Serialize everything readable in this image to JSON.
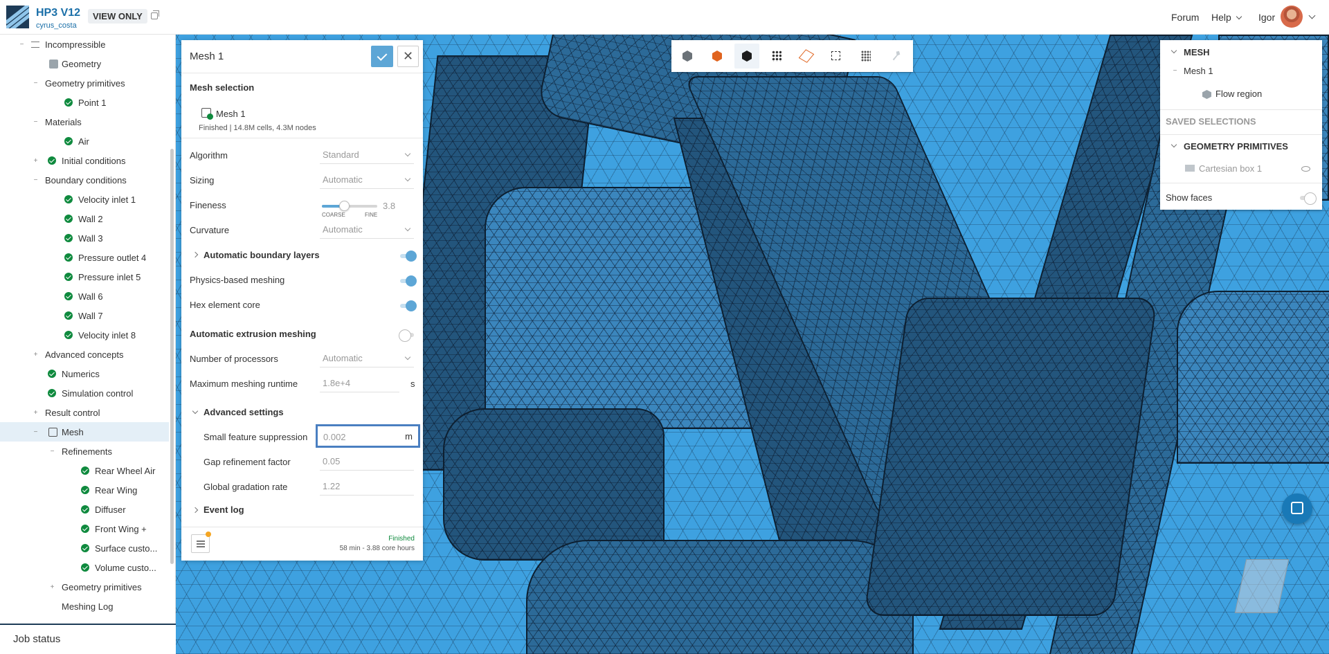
{
  "header": {
    "project_title": "HP3 V12",
    "project_owner": "cyrus_costa",
    "view_only_badge": "VIEW ONLY",
    "nav_forum": "Forum",
    "nav_help": "Help",
    "user_name": "Igor"
  },
  "tree": {
    "items": [
      {
        "label": "Incompressible"
      },
      {
        "label": "Geometry"
      },
      {
        "label": "Geometry primitives"
      },
      {
        "label": "Point 1"
      },
      {
        "label": "Materials"
      },
      {
        "label": "Air"
      },
      {
        "label": "Initial conditions"
      },
      {
        "label": "Boundary conditions"
      },
      {
        "label": "Velocity inlet 1"
      },
      {
        "label": "Wall 2"
      },
      {
        "label": "Wall 3"
      },
      {
        "label": "Pressure outlet 4"
      },
      {
        "label": "Pressure inlet 5"
      },
      {
        "label": "Wall 6"
      },
      {
        "label": "Wall 7"
      },
      {
        "label": "Velocity inlet 8"
      },
      {
        "label": "Advanced concepts"
      },
      {
        "label": "Numerics"
      },
      {
        "label": "Simulation control"
      },
      {
        "label": "Result control"
      },
      {
        "label": "Mesh"
      },
      {
        "label": "Refinements"
      },
      {
        "label": "Rear Wheel Air"
      },
      {
        "label": "Rear Wing"
      },
      {
        "label": "Diffuser"
      },
      {
        "label": "Front Wing +"
      },
      {
        "label": "Surface custo..."
      },
      {
        "label": "Volume custo..."
      },
      {
        "label": "Geometry primitives"
      },
      {
        "label": "Meshing Log"
      }
    ],
    "job_status": "Job status"
  },
  "dialog": {
    "title": "Mesh 1",
    "mesh_selection_header": "Mesh selection",
    "mesh_name": "Mesh 1",
    "mesh_info": "Finished | 14.8M cells, 4.3M nodes",
    "algorithm_label": "Algorithm",
    "algorithm_value": "Standard",
    "sizing_label": "Sizing",
    "sizing_value": "Automatic",
    "fineness_label": "Fineness",
    "fineness_value": "3.8",
    "fineness_fraction": 0.4,
    "fineness_min": "COARSE",
    "fineness_max": "FINE",
    "curvature_label": "Curvature",
    "curvature_value": "Automatic",
    "auto_boundary_layers_label": "Automatic boundary layers",
    "physics_meshing_label": "Physics-based meshing",
    "hex_core_label": "Hex element core",
    "auto_extrusion_label": "Automatic extrusion meshing",
    "processors_label": "Number of processors",
    "processors_value": "Automatic",
    "runtime_label": "Maximum meshing runtime",
    "runtime_value": "1.8e+4",
    "runtime_unit": "s",
    "advanced_settings_label": "Advanced settings",
    "small_feature_label": "Small feature suppression",
    "small_feature_value": "0.002",
    "small_feature_unit": "m",
    "gap_refinement_label": "Gap refinement factor",
    "gap_refinement_value": "0.05",
    "global_gradation_label": "Global gradation rate",
    "global_gradation_value": "1.22",
    "event_log_label": "Event log",
    "status_text": "Finished",
    "status_time": "58 min - 3.88 core hours",
    "close_glyph": "✕"
  },
  "toolbar": {
    "icons": [
      "solid-view-icon",
      "solid-edges-orange-icon",
      "solid-edges-icon",
      "points-icon",
      "wireframe-icon",
      "box-select-icon",
      "mesh-network-icon",
      "wrench-icon"
    ]
  },
  "scene": {
    "mesh_header": "MESH",
    "mesh_item": "Mesh 1",
    "flow_region": "Flow region",
    "saved_selections": "SAVED SELECTIONS",
    "geometry_primitives_header": "GEOMETRY PRIMITIVES",
    "cartesian_box": "Cartesian box 1",
    "show_faces": "Show faces"
  },
  "colors": {
    "viewport": "#3ea1e0",
    "accent": "#5da6d6",
    "success": "#0f8a3e",
    "header_dark": "#1d3b57"
  }
}
